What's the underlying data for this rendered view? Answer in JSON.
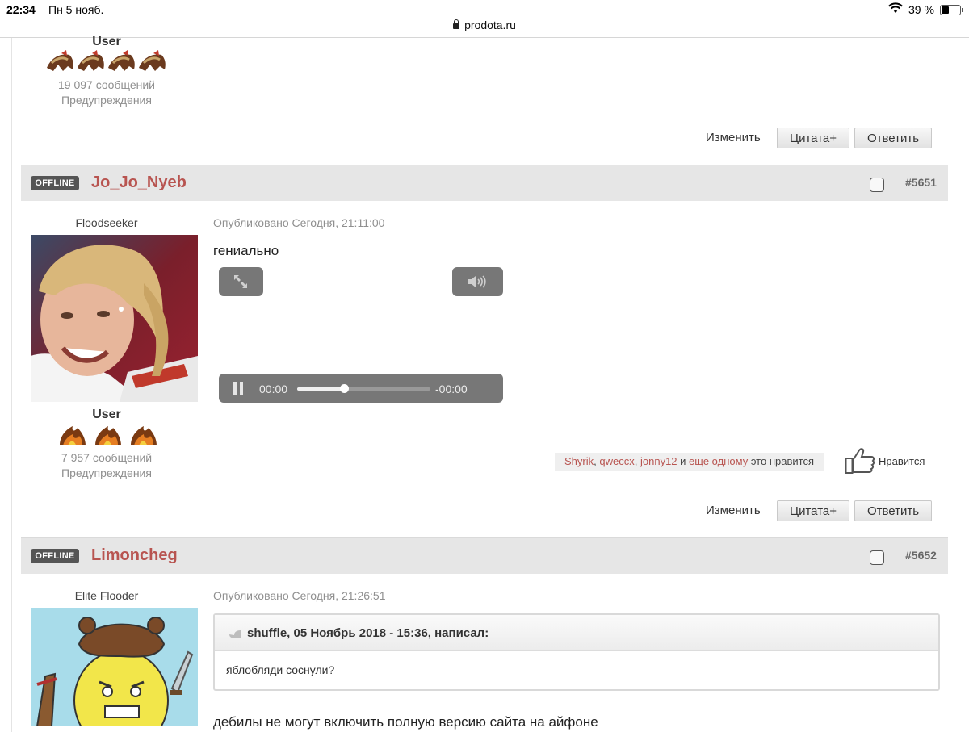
{
  "status_bar": {
    "time": "22:34",
    "date": "Пн 5 нояб.",
    "url": "prodota.ru",
    "battery": "39 %",
    "battery_level": 0.39
  },
  "colors": {
    "username": "#b85450",
    "header_bg": "#e6e6e6",
    "offline_badge": "#555555",
    "link": "#b85450"
  },
  "post_prev": {
    "rank": "User",
    "messages": "19 097 сообщений",
    "warnings": "Предупреждения",
    "stars_icon": "mount-rank-icon",
    "edit": "Изменить",
    "quote": "Цитата+",
    "reply": "Ответить"
  },
  "post_5651": {
    "status": "OFFLINE",
    "username": "Jo_Jo_Nyeb",
    "number": "#5651",
    "rank_title": "Floodseeker",
    "posted": "Опубликовано Сегодня, 21:11:00",
    "body": "гениально",
    "rank": "User",
    "messages": "7 957 сообщений",
    "warnings": "Предупреждения",
    "video": {
      "time_current": "00:00",
      "time_remaining": "-00:00",
      "progress": 0.35
    },
    "likes": {
      "users": [
        "Shyrik",
        "qweccx",
        "jonny12"
      ],
      "sep": ",",
      "and": "и",
      "more": "еще одному",
      "suffix": "это нравится",
      "button": "Нравится"
    },
    "edit": "Изменить",
    "quote": "Цитата+",
    "reply": "Ответить"
  },
  "post_5652": {
    "status": "OFFLINE",
    "username": "Limoncheg",
    "number": "#5652",
    "rank_title": "Elite Flooder",
    "posted": "Опубликовано Сегодня, 21:26:51",
    "quote_header": "shuffle, 05 Ноябрь 2018 - 15:36, написал:",
    "quote_text": "яблобляди соснули?",
    "body": "дебилы не могут включить полную версию сайта на айфоне"
  }
}
